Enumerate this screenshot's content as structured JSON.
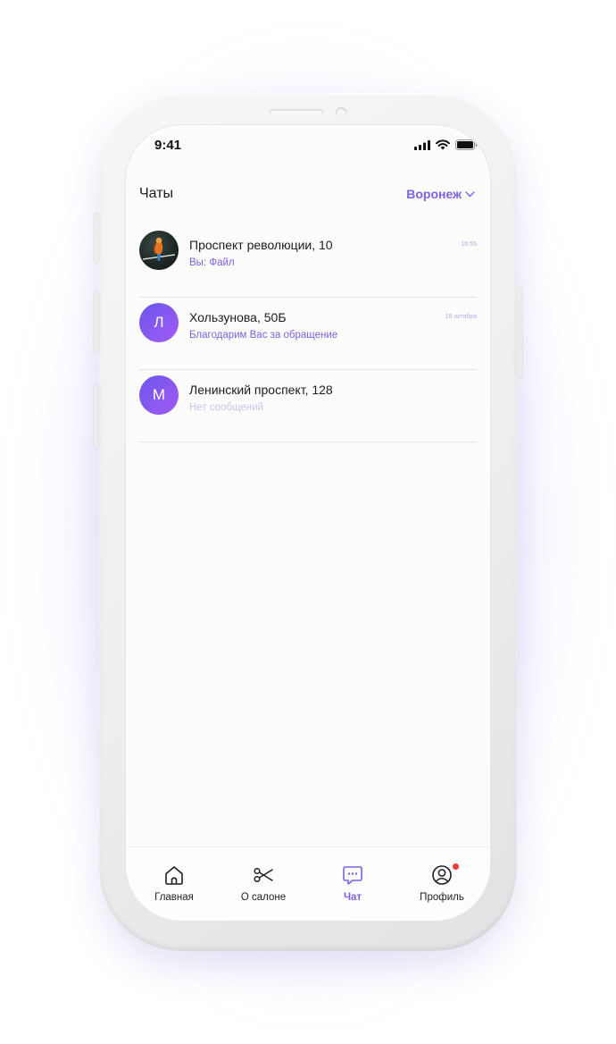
{
  "status_bar": {
    "time": "9:41"
  },
  "header": {
    "title": "Чаты",
    "city": "Воронеж"
  },
  "chats": [
    {
      "name": "Проспект революции, 10",
      "preview": "Вы: Файл",
      "time": "16:55"
    },
    {
      "name": "Хользунова, 50Б",
      "preview": "Благодарим Вас за обращение",
      "time": "18 октября",
      "avatar_letter": "Л"
    },
    {
      "name": "Ленинский проспект, 128",
      "preview": "Нет сообщений",
      "time": "",
      "avatar_letter": "М"
    }
  ],
  "tabbar": {
    "items": [
      {
        "label": "Главная",
        "icon": "home-icon"
      },
      {
        "label": "О салоне",
        "icon": "scissors-icon"
      },
      {
        "label": "Чат",
        "icon": "chat-icon",
        "active": true
      },
      {
        "label": "Профиль",
        "icon": "profile-icon",
        "badge": true
      }
    ]
  },
  "colors": {
    "accent": "#7b61e8",
    "badge": "#ee3b3b"
  }
}
